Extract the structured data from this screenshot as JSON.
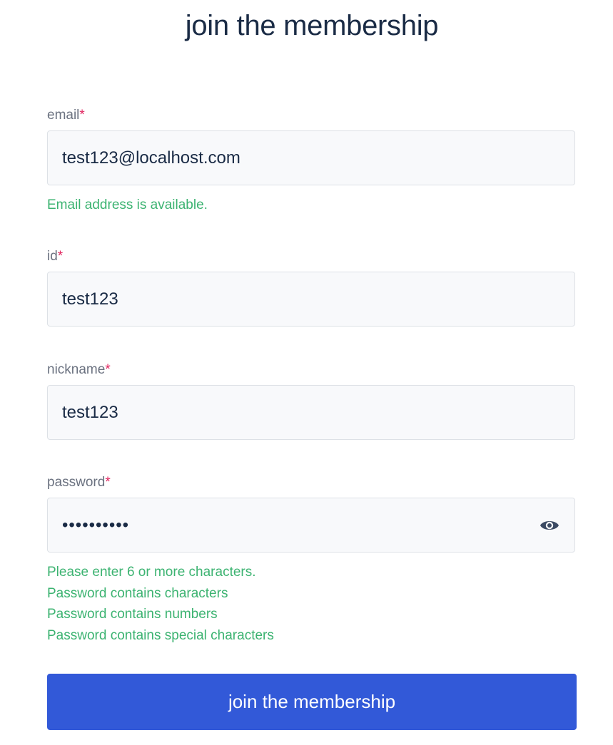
{
  "page": {
    "title": "join the membership"
  },
  "form": {
    "required_mark": "*",
    "email": {
      "label": "email",
      "value": "test123@localhost.com",
      "message": "Email address is available."
    },
    "id": {
      "label": "id",
      "value": "test123"
    },
    "nickname": {
      "label": "nickname",
      "value": "test123"
    },
    "password": {
      "label": "password",
      "value": "abcdef1234",
      "toggle_icon": "eye-icon",
      "messages": [
        "Please enter 6 or more characters.",
        "Password contains characters",
        "Password contains numbers",
        "Password contains special characters"
      ]
    },
    "submit_label": "join the membership"
  },
  "colors": {
    "accent": "#3259d8",
    "success": "#3cb371",
    "required": "#e0245e",
    "title": "#1a2b45"
  }
}
